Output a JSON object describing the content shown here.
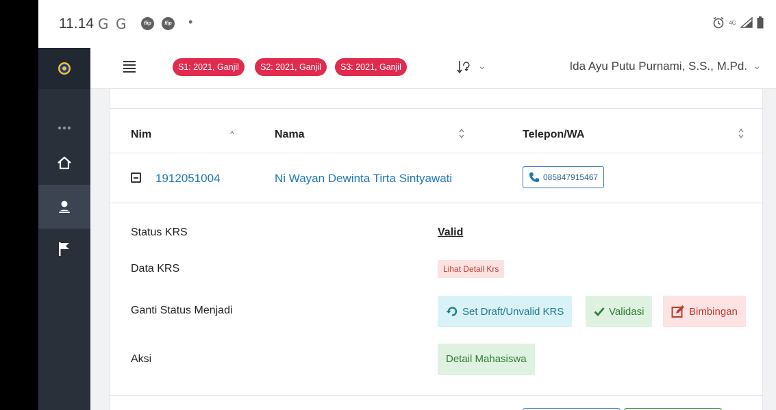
{
  "status_bar": {
    "time": "11.14",
    "google_glyph": "G",
    "flip_label": "flip",
    "dot": "•",
    "alarm_icon": "alarm-icon",
    "network_label": "4G",
    "signal_icon": "signal-icon",
    "battery_icon": "battery-icon"
  },
  "sidebar": {
    "items": [
      {
        "name": "logo",
        "icon": "university-logo-icon",
        "active": false
      },
      {
        "name": "more",
        "icon": "more-dots-icon",
        "active": false
      },
      {
        "name": "home",
        "icon": "home-icon",
        "active": false
      },
      {
        "name": "students",
        "icon": "user-icon",
        "active": true
      },
      {
        "name": "flag",
        "icon": "flag-icon",
        "active": false
      }
    ]
  },
  "topbar": {
    "semesters": [
      "S1: 2021, Ganjil",
      "S2: 2021, Ganjil",
      "S3: 2021, Ganjil"
    ],
    "username": "Ida Ayu Putu Purnami, S.S., M.Pd.",
    "chevron": "⌄"
  },
  "table": {
    "headers": {
      "nim": "Nim",
      "nama": "Nama",
      "telepon": "Telepon/WA"
    },
    "nim_sort_arrow": "^",
    "row": {
      "nim": "1912051004",
      "nama": "Ni Wayan Dewinta Tirta Sintyawati",
      "telepon": "085847915467"
    }
  },
  "detail": {
    "status_krs_label": "Status KRS",
    "status_krs_value": "Valid",
    "data_krs_label": "Data KRS",
    "lihat_detail_krs": "Lihat Detail Krs",
    "ganti_status_label": "Ganti Status Menjadi",
    "btn_draft": "Set Draft/Unvalid KRS",
    "btn_validasi": "Validasi",
    "btn_bimbingan": "Bimbingan",
    "aksi_label": "Aksi",
    "btn_detail_mahasiswa": "Detail Mahasiswa"
  },
  "colors": {
    "pill_red": "#e02b4e",
    "sidebar_dark": "#2a303a",
    "link_blue": "#1f78b8",
    "success_green": "#2e7d32",
    "info_teal": "#1f7a8c",
    "danger_red": "#c0392b"
  }
}
